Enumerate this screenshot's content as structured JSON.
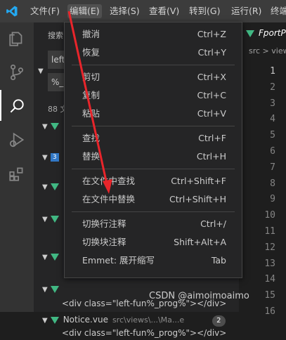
{
  "menubar": {
    "items": [
      "文件(F)",
      "编辑(E)",
      "选择(S)",
      "查看(V)",
      "转到(G)",
      "运行(R)",
      "终端"
    ]
  },
  "sidebar": {
    "title": "搜索",
    "search_value": "left",
    "replace_value": "%_",
    "result_summary": "88 文",
    "files": [
      {
        "name": "Notice.vue",
        "path": "src\\views\\...\\Ma...e",
        "count": "2"
      }
    ],
    "match_line": "<div class=\"left-fun%_prog%\"></div>",
    "match_line2": "<div class=\"left-fun%_prog%\"></div>"
  },
  "editor": {
    "tab_title": "FportP",
    "breadcrumb": "src > view",
    "line_numbers": [
      "1",
      "2",
      "3",
      "4",
      "5",
      "6",
      "7",
      "8",
      "9",
      "10",
      "11",
      "12",
      "13",
      "14",
      "15",
      "16"
    ]
  },
  "menu": {
    "groups": [
      [
        {
          "label": "撤消",
          "shortcut": "Ctrl+Z"
        },
        {
          "label": "恢复",
          "shortcut": "Ctrl+Y"
        }
      ],
      [
        {
          "label": "剪切",
          "shortcut": "Ctrl+X"
        },
        {
          "label": "复制",
          "shortcut": "Ctrl+C"
        },
        {
          "label": "粘贴",
          "shortcut": "Ctrl+V"
        }
      ],
      [
        {
          "label": "查找",
          "shortcut": "Ctrl+F"
        },
        {
          "label": "替换",
          "shortcut": "Ctrl+H"
        }
      ],
      [
        {
          "label": "在文件中查找",
          "shortcut": "Ctrl+Shift+F"
        },
        {
          "label": "在文件中替换",
          "shortcut": "Ctrl+Shift+H"
        }
      ],
      [
        {
          "label": "切换行注释",
          "shortcut": "Ctrl+/"
        },
        {
          "label": "切换块注释",
          "shortcut": "Shift+Alt+A"
        },
        {
          "label": "Emmet: 展开缩写",
          "shortcut": "Tab"
        }
      ]
    ]
  },
  "watermark": "CSDN @aimoimoaimo",
  "colors": {
    "accent": "#007acc",
    "vue_green": "#41b883",
    "annotation_arrow": "#e8252b",
    "menu_bg": "#252526"
  }
}
